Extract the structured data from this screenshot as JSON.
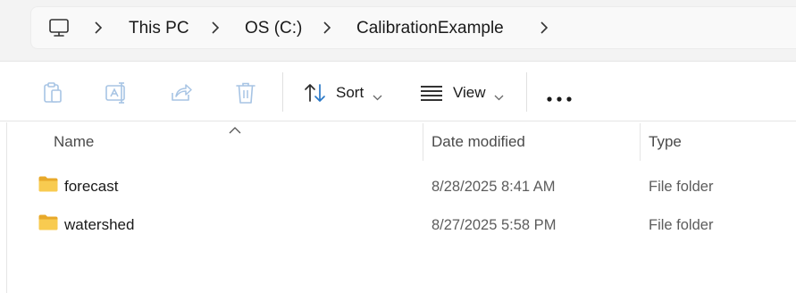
{
  "breadcrumb": {
    "root_icon": "computer-icon",
    "items": [
      "This PC",
      "OS (C:)",
      "CalibrationExample"
    ]
  },
  "toolbar": {
    "copy_icon": "clipboard-icon",
    "rename_icon": "rename-icon",
    "share_icon": "share-icon",
    "delete_icon": "trash-icon",
    "sort_label": "Sort",
    "view_label": "View",
    "more_icon": "more-icon"
  },
  "columns": {
    "name": "Name",
    "date_modified": "Date modified",
    "type": "Type"
  },
  "files": [
    {
      "name": "forecast",
      "date_modified": "8/28/2025 8:41 AM",
      "type": "File folder"
    },
    {
      "name": "watershed",
      "date_modified": "8/27/2025 5:58 PM",
      "type": "File folder"
    }
  ],
  "colors": {
    "folder": "#f6c244",
    "folder_dark": "#e8a92a",
    "disabled_icon": "#a7c4e4"
  }
}
